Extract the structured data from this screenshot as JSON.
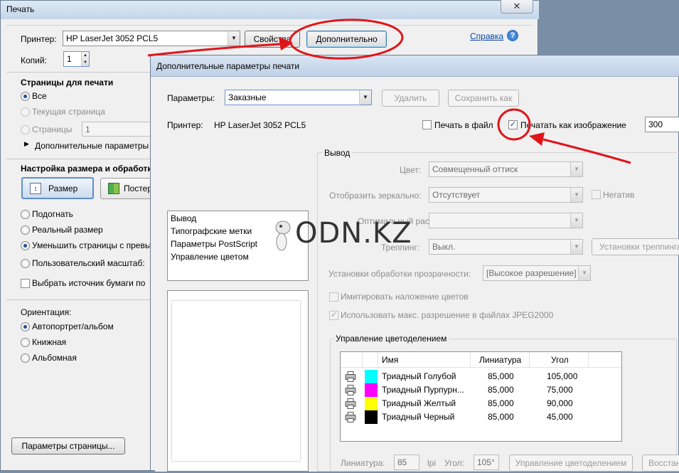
{
  "print": {
    "title": "Печать",
    "close_glyph": "✕",
    "printer_label": "Принтер:",
    "printer_value": "HP LaserJet 3052 PCL5",
    "properties_btn": "Свойства",
    "advanced_btn": "Дополнительно",
    "help_link": "Справка",
    "copies_label": "Копий:",
    "copies_value": "1",
    "pages_section": "Страницы для печати",
    "all": "Все",
    "current_page": "Текущая страница",
    "pages": "Страницы",
    "pages_value": "1",
    "more_options": "Дополнительные параметры",
    "size_section": "Настройка размера и обработк",
    "size_btn": "Размер",
    "poster_btn": "Постер",
    "fit": "Подогнать",
    "actual_size": "Реальный размер",
    "shrink": "Уменьшить страницы с превы",
    "custom_scale": "Пользовательский масштаб:",
    "paper_source": "Выбрать источник бумаги по",
    "orientation_label": "Ориентация:",
    "auto_orientation": "Автопортрет/альбом",
    "portrait": "Книжная",
    "landscape": "Альбомная",
    "page_setup_btn": "Параметры страницы..."
  },
  "advanced": {
    "title": "Дополнительные параметры печати",
    "params_label": "Параметры:",
    "params_value": "Заказные",
    "delete_btn": "Удалить",
    "save_as_btn": "Сохранить как",
    "printer_label": "Принтер:",
    "printer_value": "HP LaserJet 3052 PCL5",
    "print_to_file": "Печать в файл",
    "print_as_image": "Печатать как изображение",
    "dpi_value": "300",
    "categories": [
      "Вывод",
      "Типографские метки",
      "Параметры PostScript",
      "Управление цветом"
    ],
    "output": {
      "title": "Вывод",
      "color_label": "Цвет:",
      "color_value": "Совмещенный оттиск",
      "mirror_label": "Отобразить зеркально:",
      "mirror_value": "Отсутствует",
      "negative": "Негатив",
      "screen_label": "Оптимальный растр:",
      "screen_value": "",
      "trapping_label": "Треппинг:",
      "trapping_value": "Выкл.",
      "trap_settings_btn": "Установки треппинга",
      "transparency_label": "Установки обработки прозрачности:",
      "transparency_value": "[Высокое разрешение]",
      "simulate_overprint": "Имитировать наложение цветов",
      "max_jpeg": "Использовать макс. разрешение в файлах JPEG2000"
    },
    "separations": {
      "title": "Управление цветоделением",
      "columns": [
        "Имя",
        "Линиатура",
        "Угол"
      ],
      "rows": [
        {
          "name": "Триадный Голубой",
          "frequency": "85,000",
          "angle": "105,000",
          "color": "#00ffff"
        },
        {
          "name": "Триадный Пурпурн...",
          "frequency": "85,000",
          "angle": "75,000",
          "color": "#ff00ff"
        },
        {
          "name": "Триадный Желтый",
          "frequency": "85,000",
          "angle": "90,000",
          "color": "#ffff00"
        },
        {
          "name": "Триадный Черный",
          "frequency": "85,000",
          "angle": "45,000",
          "color": "#000000"
        }
      ],
      "frequency_label": "Линиатура:",
      "frequency_value": "85",
      "lpi_label": "lpi",
      "angle_label": "Угол:",
      "angle_value": "105°",
      "ink_manager_btn": "Управление цветоделением",
      "restore_btn": "Восстан"
    }
  },
  "watermark": "ODN.KZ",
  "colors": {
    "annotation_red": "#e0151b",
    "link_blue": "#0645ad"
  },
  "icons": [
    "help-icon",
    "close-icon",
    "printer-icon",
    "dropdown-arrow-icon",
    "expand-triangle-icon",
    "size-icon",
    "poster-icon"
  ]
}
